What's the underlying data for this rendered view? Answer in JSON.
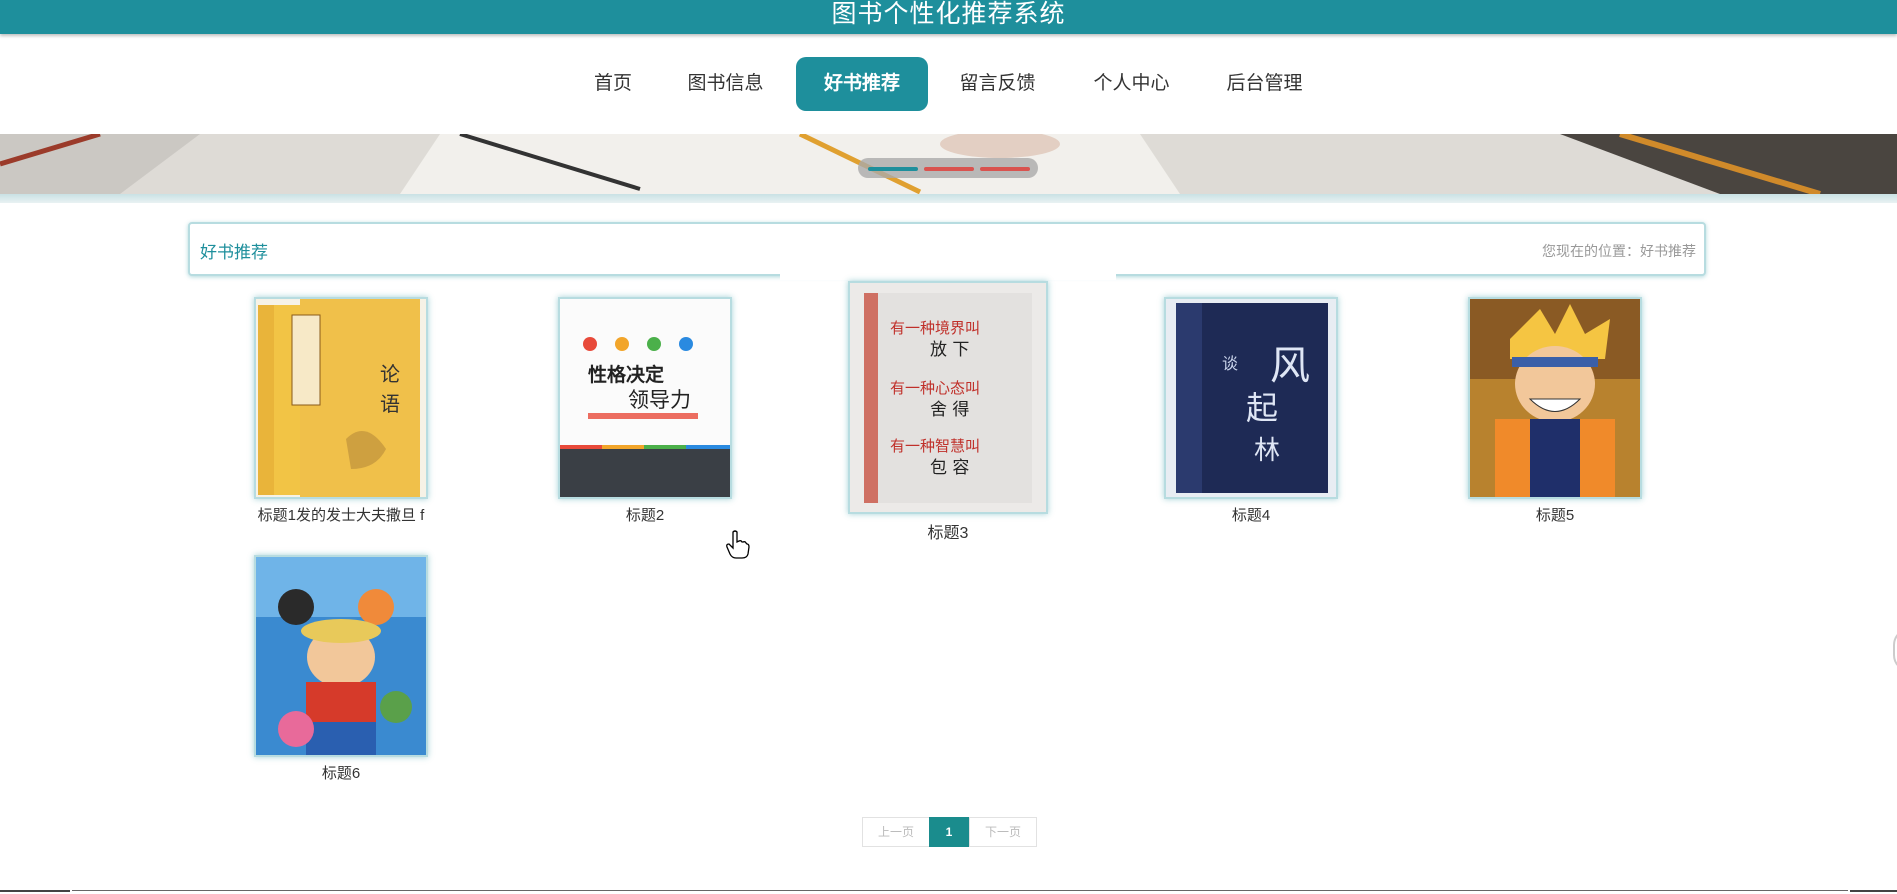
{
  "header": {
    "title": "图书个性化推荐系统"
  },
  "nav": {
    "items": [
      {
        "label": "首页"
      },
      {
        "label": "图书信息"
      },
      {
        "label": "好书推荐"
      },
      {
        "label": "留言反馈"
      },
      {
        "label": "个人中心"
      },
      {
        "label": "后台管理"
      }
    ],
    "active_index": 2
  },
  "carousel": {
    "slide_count": 3,
    "active_index": 0,
    "active_color": "#1e8f9c",
    "inactive_color": "#d9534f"
  },
  "section": {
    "title": "好书推荐",
    "breadcrumb": "您现在的位置：好书推荐"
  },
  "books": [
    {
      "title": "标题1发的发士大夫撒旦 f",
      "cover": "analects-book-cover"
    },
    {
      "title": "标题2",
      "cover": "personality-leadership-book-cover"
    },
    {
      "title": "标题3",
      "cover": "calligraphy-book-cover"
    },
    {
      "title": "标题4",
      "cover": "wind-forest-book-cover"
    },
    {
      "title": "标题5",
      "cover": "naruto-cover"
    },
    {
      "title": "标题6",
      "cover": "one-piece-cover"
    }
  ],
  "pagination": {
    "prev": "上一页",
    "current": "1",
    "next": "下一页"
  },
  "colors": {
    "accent": "#1e8f9c",
    "pager_active": "#1a8c8d"
  }
}
